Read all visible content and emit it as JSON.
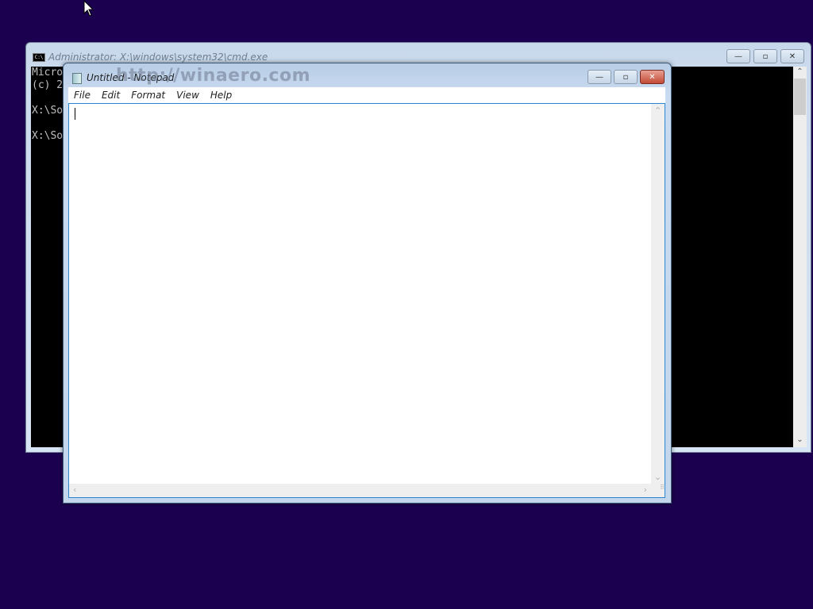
{
  "desktop": {
    "background": "#1c0050"
  },
  "cmd": {
    "title": "Administrator: X:\\windows\\system32\\cmd.exe",
    "icon": "console-icon",
    "lines": [
      "Micro",
      "(c) 2",
      "",
      "X:\\So",
      "",
      "X:\\So"
    ],
    "buttons": {
      "minimize": "—",
      "maximize": "▫",
      "close": "✕"
    }
  },
  "notepad": {
    "title": "Untitled - Notepad",
    "watermark": "http://winaero.com",
    "menu": [
      "File",
      "Edit",
      "Format",
      "View",
      "Help"
    ],
    "content": "",
    "buttons": {
      "minimize": "—",
      "maximize": "▫",
      "close": "✕"
    }
  }
}
